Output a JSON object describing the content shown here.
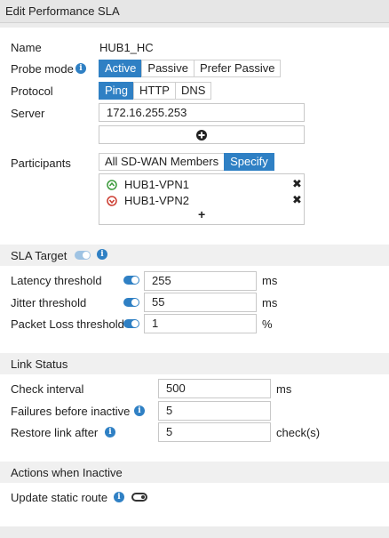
{
  "title": "Edit Performance SLA",
  "general": {
    "name_label": "Name",
    "name_value": "HUB1_HC",
    "probe_mode_label": "Probe mode",
    "probe_modes": [
      "Active",
      "Passive",
      "Prefer Passive"
    ],
    "probe_mode_selected": "Active",
    "protocol_label": "Protocol",
    "protocols": [
      "Ping",
      "HTTP",
      "DNS"
    ],
    "protocol_selected": "Ping",
    "server_label": "Server",
    "server_value": "172.16.255.253",
    "add_server_icon": "plus-circle-icon",
    "participants_label": "Participants",
    "participant_modes": [
      "All SD-WAN Members",
      "Specify"
    ],
    "participant_mode_selected": "Specify",
    "participants": [
      {
        "name": "HUB1-VPN1",
        "status": "up",
        "status_color": "#3a9a3a"
      },
      {
        "name": "HUB1-VPN2",
        "status": "down",
        "status_color": "#cc3b2f"
      }
    ],
    "add_participant": "+"
  },
  "sla_target": {
    "heading": "SLA Target",
    "rows": [
      {
        "label": "Latency threshold",
        "value": "255",
        "unit": "ms"
      },
      {
        "label": "Jitter threshold",
        "value": "55",
        "unit": "ms"
      },
      {
        "label": "Packet Loss threshold",
        "value": "1",
        "unit": "%"
      }
    ]
  },
  "link_status": {
    "heading": "Link Status",
    "rows": [
      {
        "label": "Check interval",
        "value": "500",
        "unit": "ms"
      },
      {
        "label": "Failures before inactive",
        "value": "5",
        "unit": ""
      },
      {
        "label": "Restore link after",
        "value": "5",
        "unit": "check(s)"
      }
    ]
  },
  "actions": {
    "heading": "Actions when Inactive",
    "update_static_route_label": "Update static route",
    "update_static_route_enabled": false
  },
  "colors": {
    "accent": "#2f80c4",
    "status_up": "#3a9a3a",
    "status_down": "#cc3b2f"
  }
}
